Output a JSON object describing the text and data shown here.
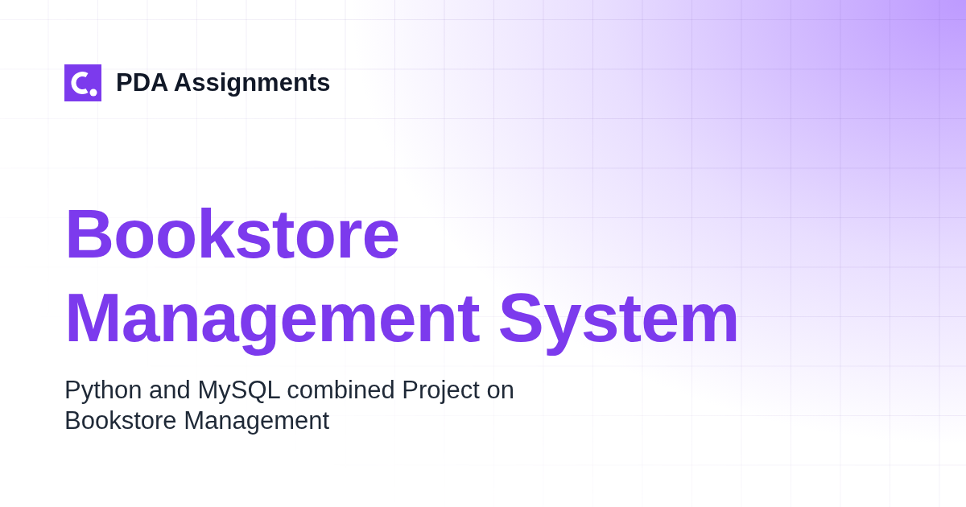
{
  "brand": {
    "name": "PDA Assignments"
  },
  "title_lines": [
    "Bookstore",
    "Management System"
  ],
  "subtitle_lines": [
    "Python and MySQL combined Project on",
    "Bookstore Management"
  ]
}
